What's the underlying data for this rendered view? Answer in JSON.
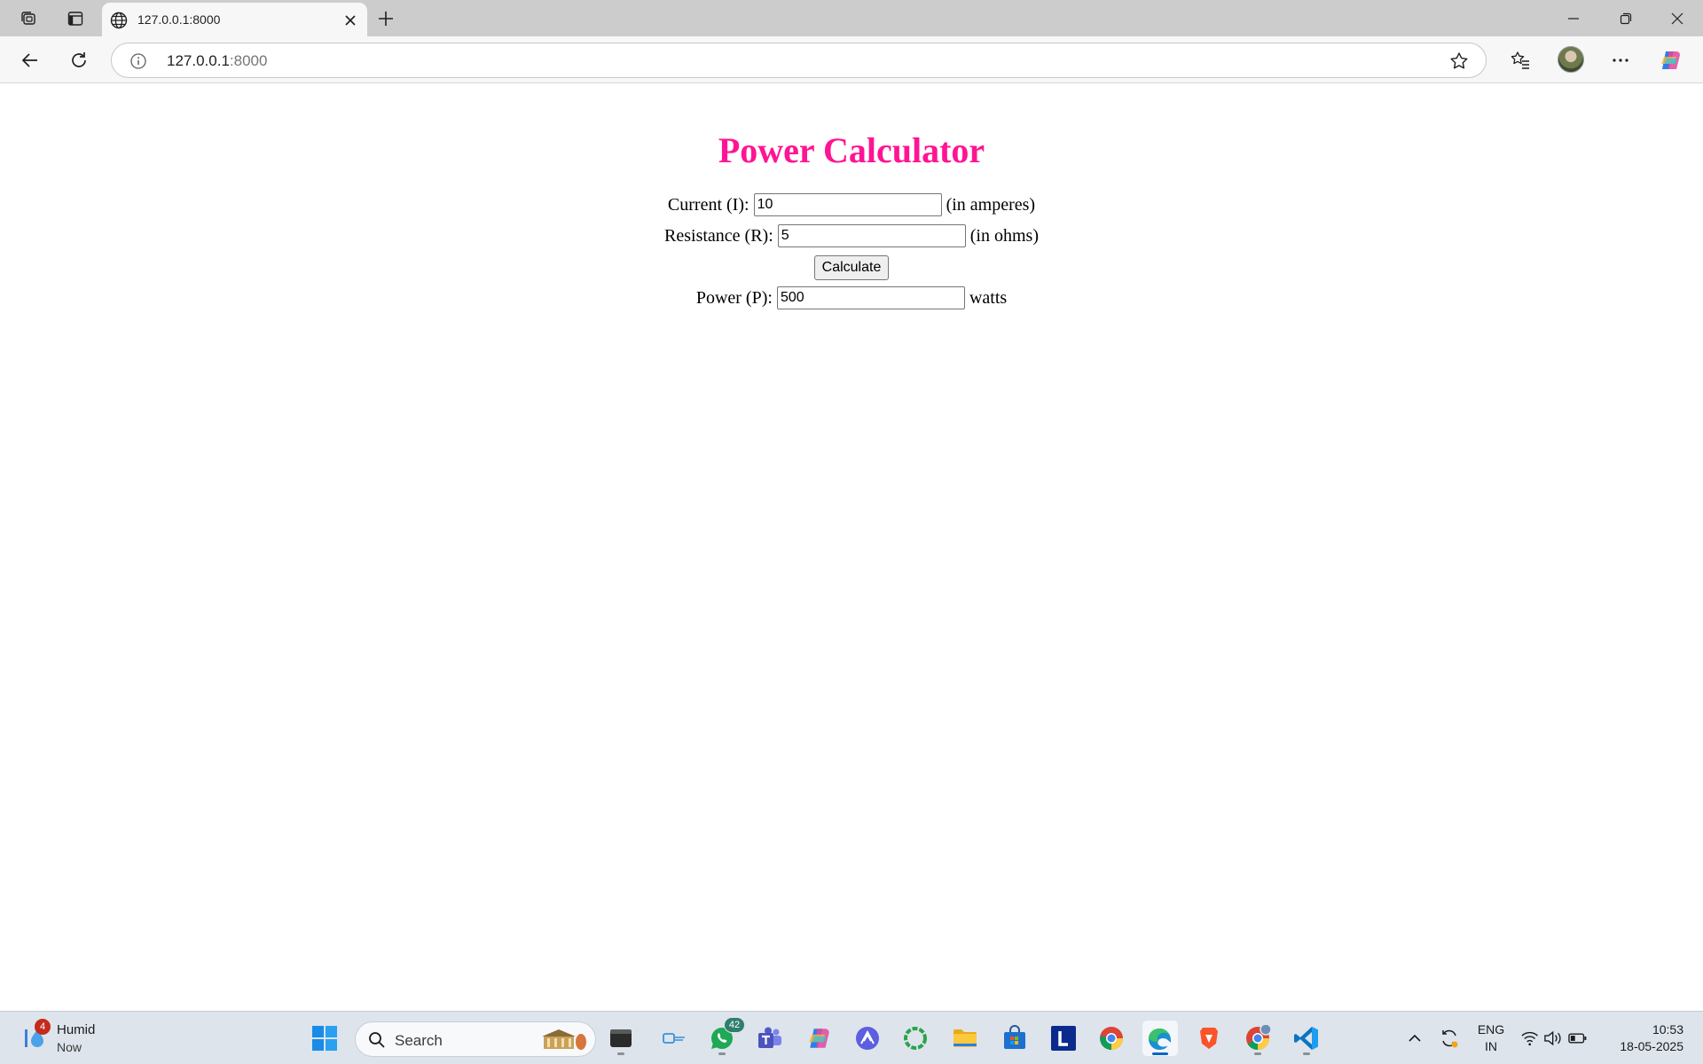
{
  "browser": {
    "tab": {
      "title": "127.0.0.1:8000",
      "favicon": "globe-icon"
    },
    "address": {
      "host": "127.0.0.1",
      "port": ":8000",
      "info_icon": "info-icon"
    }
  },
  "page": {
    "title": "Power Calculator",
    "current": {
      "label": "Current (I):",
      "value": "10",
      "unit": "(in amperes)"
    },
    "resistance": {
      "label": "Resistance (R):",
      "value": "5",
      "unit": "(in ohms)"
    },
    "calculate_label": "Calculate",
    "power": {
      "label": "Power (P):",
      "value": "500",
      "unit": "watts"
    },
    "title_color": "#ff1493"
  },
  "taskbar": {
    "weather": {
      "title": "Humid",
      "subtitle": "Now",
      "badge": "4"
    },
    "search_label": "Search",
    "whatsapp_badge": "42",
    "lang_line1": "ENG",
    "lang_line2": "IN",
    "time": "10:53",
    "date": "18-05-2025"
  }
}
